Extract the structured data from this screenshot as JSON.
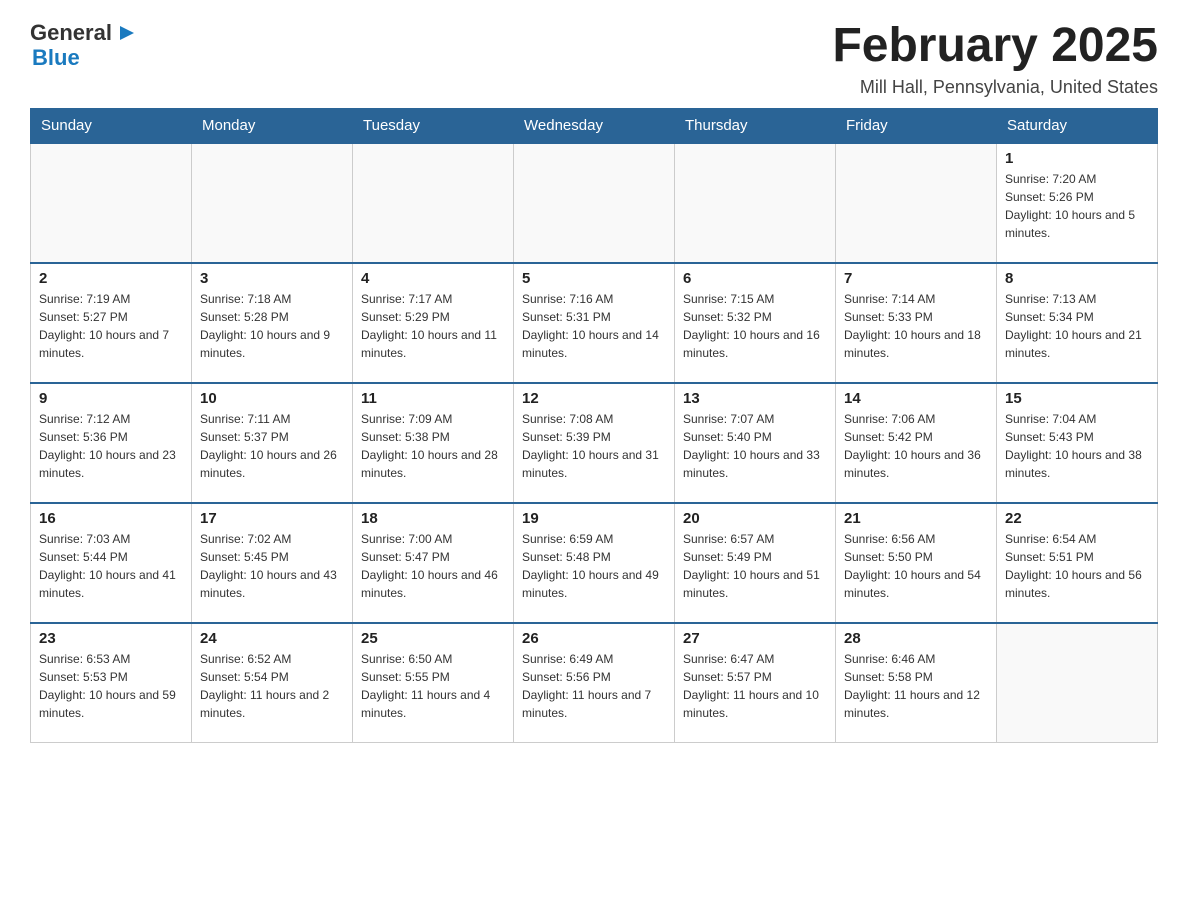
{
  "header": {
    "logo": {
      "general": "General",
      "arrow": "▶",
      "blue": "Blue"
    },
    "title": "February 2025",
    "location": "Mill Hall, Pennsylvania, United States"
  },
  "days_header": [
    "Sunday",
    "Monday",
    "Tuesday",
    "Wednesday",
    "Thursday",
    "Friday",
    "Saturday"
  ],
  "weeks": [
    [
      {
        "day": "",
        "info": ""
      },
      {
        "day": "",
        "info": ""
      },
      {
        "day": "",
        "info": ""
      },
      {
        "day": "",
        "info": ""
      },
      {
        "day": "",
        "info": ""
      },
      {
        "day": "",
        "info": ""
      },
      {
        "day": "1",
        "info": "Sunrise: 7:20 AM\nSunset: 5:26 PM\nDaylight: 10 hours and 5 minutes."
      }
    ],
    [
      {
        "day": "2",
        "info": "Sunrise: 7:19 AM\nSunset: 5:27 PM\nDaylight: 10 hours and 7 minutes."
      },
      {
        "day": "3",
        "info": "Sunrise: 7:18 AM\nSunset: 5:28 PM\nDaylight: 10 hours and 9 minutes."
      },
      {
        "day": "4",
        "info": "Sunrise: 7:17 AM\nSunset: 5:29 PM\nDaylight: 10 hours and 11 minutes."
      },
      {
        "day": "5",
        "info": "Sunrise: 7:16 AM\nSunset: 5:31 PM\nDaylight: 10 hours and 14 minutes."
      },
      {
        "day": "6",
        "info": "Sunrise: 7:15 AM\nSunset: 5:32 PM\nDaylight: 10 hours and 16 minutes."
      },
      {
        "day": "7",
        "info": "Sunrise: 7:14 AM\nSunset: 5:33 PM\nDaylight: 10 hours and 18 minutes."
      },
      {
        "day": "8",
        "info": "Sunrise: 7:13 AM\nSunset: 5:34 PM\nDaylight: 10 hours and 21 minutes."
      }
    ],
    [
      {
        "day": "9",
        "info": "Sunrise: 7:12 AM\nSunset: 5:36 PM\nDaylight: 10 hours and 23 minutes."
      },
      {
        "day": "10",
        "info": "Sunrise: 7:11 AM\nSunset: 5:37 PM\nDaylight: 10 hours and 26 minutes."
      },
      {
        "day": "11",
        "info": "Sunrise: 7:09 AM\nSunset: 5:38 PM\nDaylight: 10 hours and 28 minutes."
      },
      {
        "day": "12",
        "info": "Sunrise: 7:08 AM\nSunset: 5:39 PM\nDaylight: 10 hours and 31 minutes."
      },
      {
        "day": "13",
        "info": "Sunrise: 7:07 AM\nSunset: 5:40 PM\nDaylight: 10 hours and 33 minutes."
      },
      {
        "day": "14",
        "info": "Sunrise: 7:06 AM\nSunset: 5:42 PM\nDaylight: 10 hours and 36 minutes."
      },
      {
        "day": "15",
        "info": "Sunrise: 7:04 AM\nSunset: 5:43 PM\nDaylight: 10 hours and 38 minutes."
      }
    ],
    [
      {
        "day": "16",
        "info": "Sunrise: 7:03 AM\nSunset: 5:44 PM\nDaylight: 10 hours and 41 minutes."
      },
      {
        "day": "17",
        "info": "Sunrise: 7:02 AM\nSunset: 5:45 PM\nDaylight: 10 hours and 43 minutes."
      },
      {
        "day": "18",
        "info": "Sunrise: 7:00 AM\nSunset: 5:47 PM\nDaylight: 10 hours and 46 minutes."
      },
      {
        "day": "19",
        "info": "Sunrise: 6:59 AM\nSunset: 5:48 PM\nDaylight: 10 hours and 49 minutes."
      },
      {
        "day": "20",
        "info": "Sunrise: 6:57 AM\nSunset: 5:49 PM\nDaylight: 10 hours and 51 minutes."
      },
      {
        "day": "21",
        "info": "Sunrise: 6:56 AM\nSunset: 5:50 PM\nDaylight: 10 hours and 54 minutes."
      },
      {
        "day": "22",
        "info": "Sunrise: 6:54 AM\nSunset: 5:51 PM\nDaylight: 10 hours and 56 minutes."
      }
    ],
    [
      {
        "day": "23",
        "info": "Sunrise: 6:53 AM\nSunset: 5:53 PM\nDaylight: 10 hours and 59 minutes."
      },
      {
        "day": "24",
        "info": "Sunrise: 6:52 AM\nSunset: 5:54 PM\nDaylight: 11 hours and 2 minutes."
      },
      {
        "day": "25",
        "info": "Sunrise: 6:50 AM\nSunset: 5:55 PM\nDaylight: 11 hours and 4 minutes."
      },
      {
        "day": "26",
        "info": "Sunrise: 6:49 AM\nSunset: 5:56 PM\nDaylight: 11 hours and 7 minutes."
      },
      {
        "day": "27",
        "info": "Sunrise: 6:47 AM\nSunset: 5:57 PM\nDaylight: 11 hours and 10 minutes."
      },
      {
        "day": "28",
        "info": "Sunrise: 6:46 AM\nSunset: 5:58 PM\nDaylight: 11 hours and 12 minutes."
      },
      {
        "day": "",
        "info": ""
      }
    ]
  ]
}
